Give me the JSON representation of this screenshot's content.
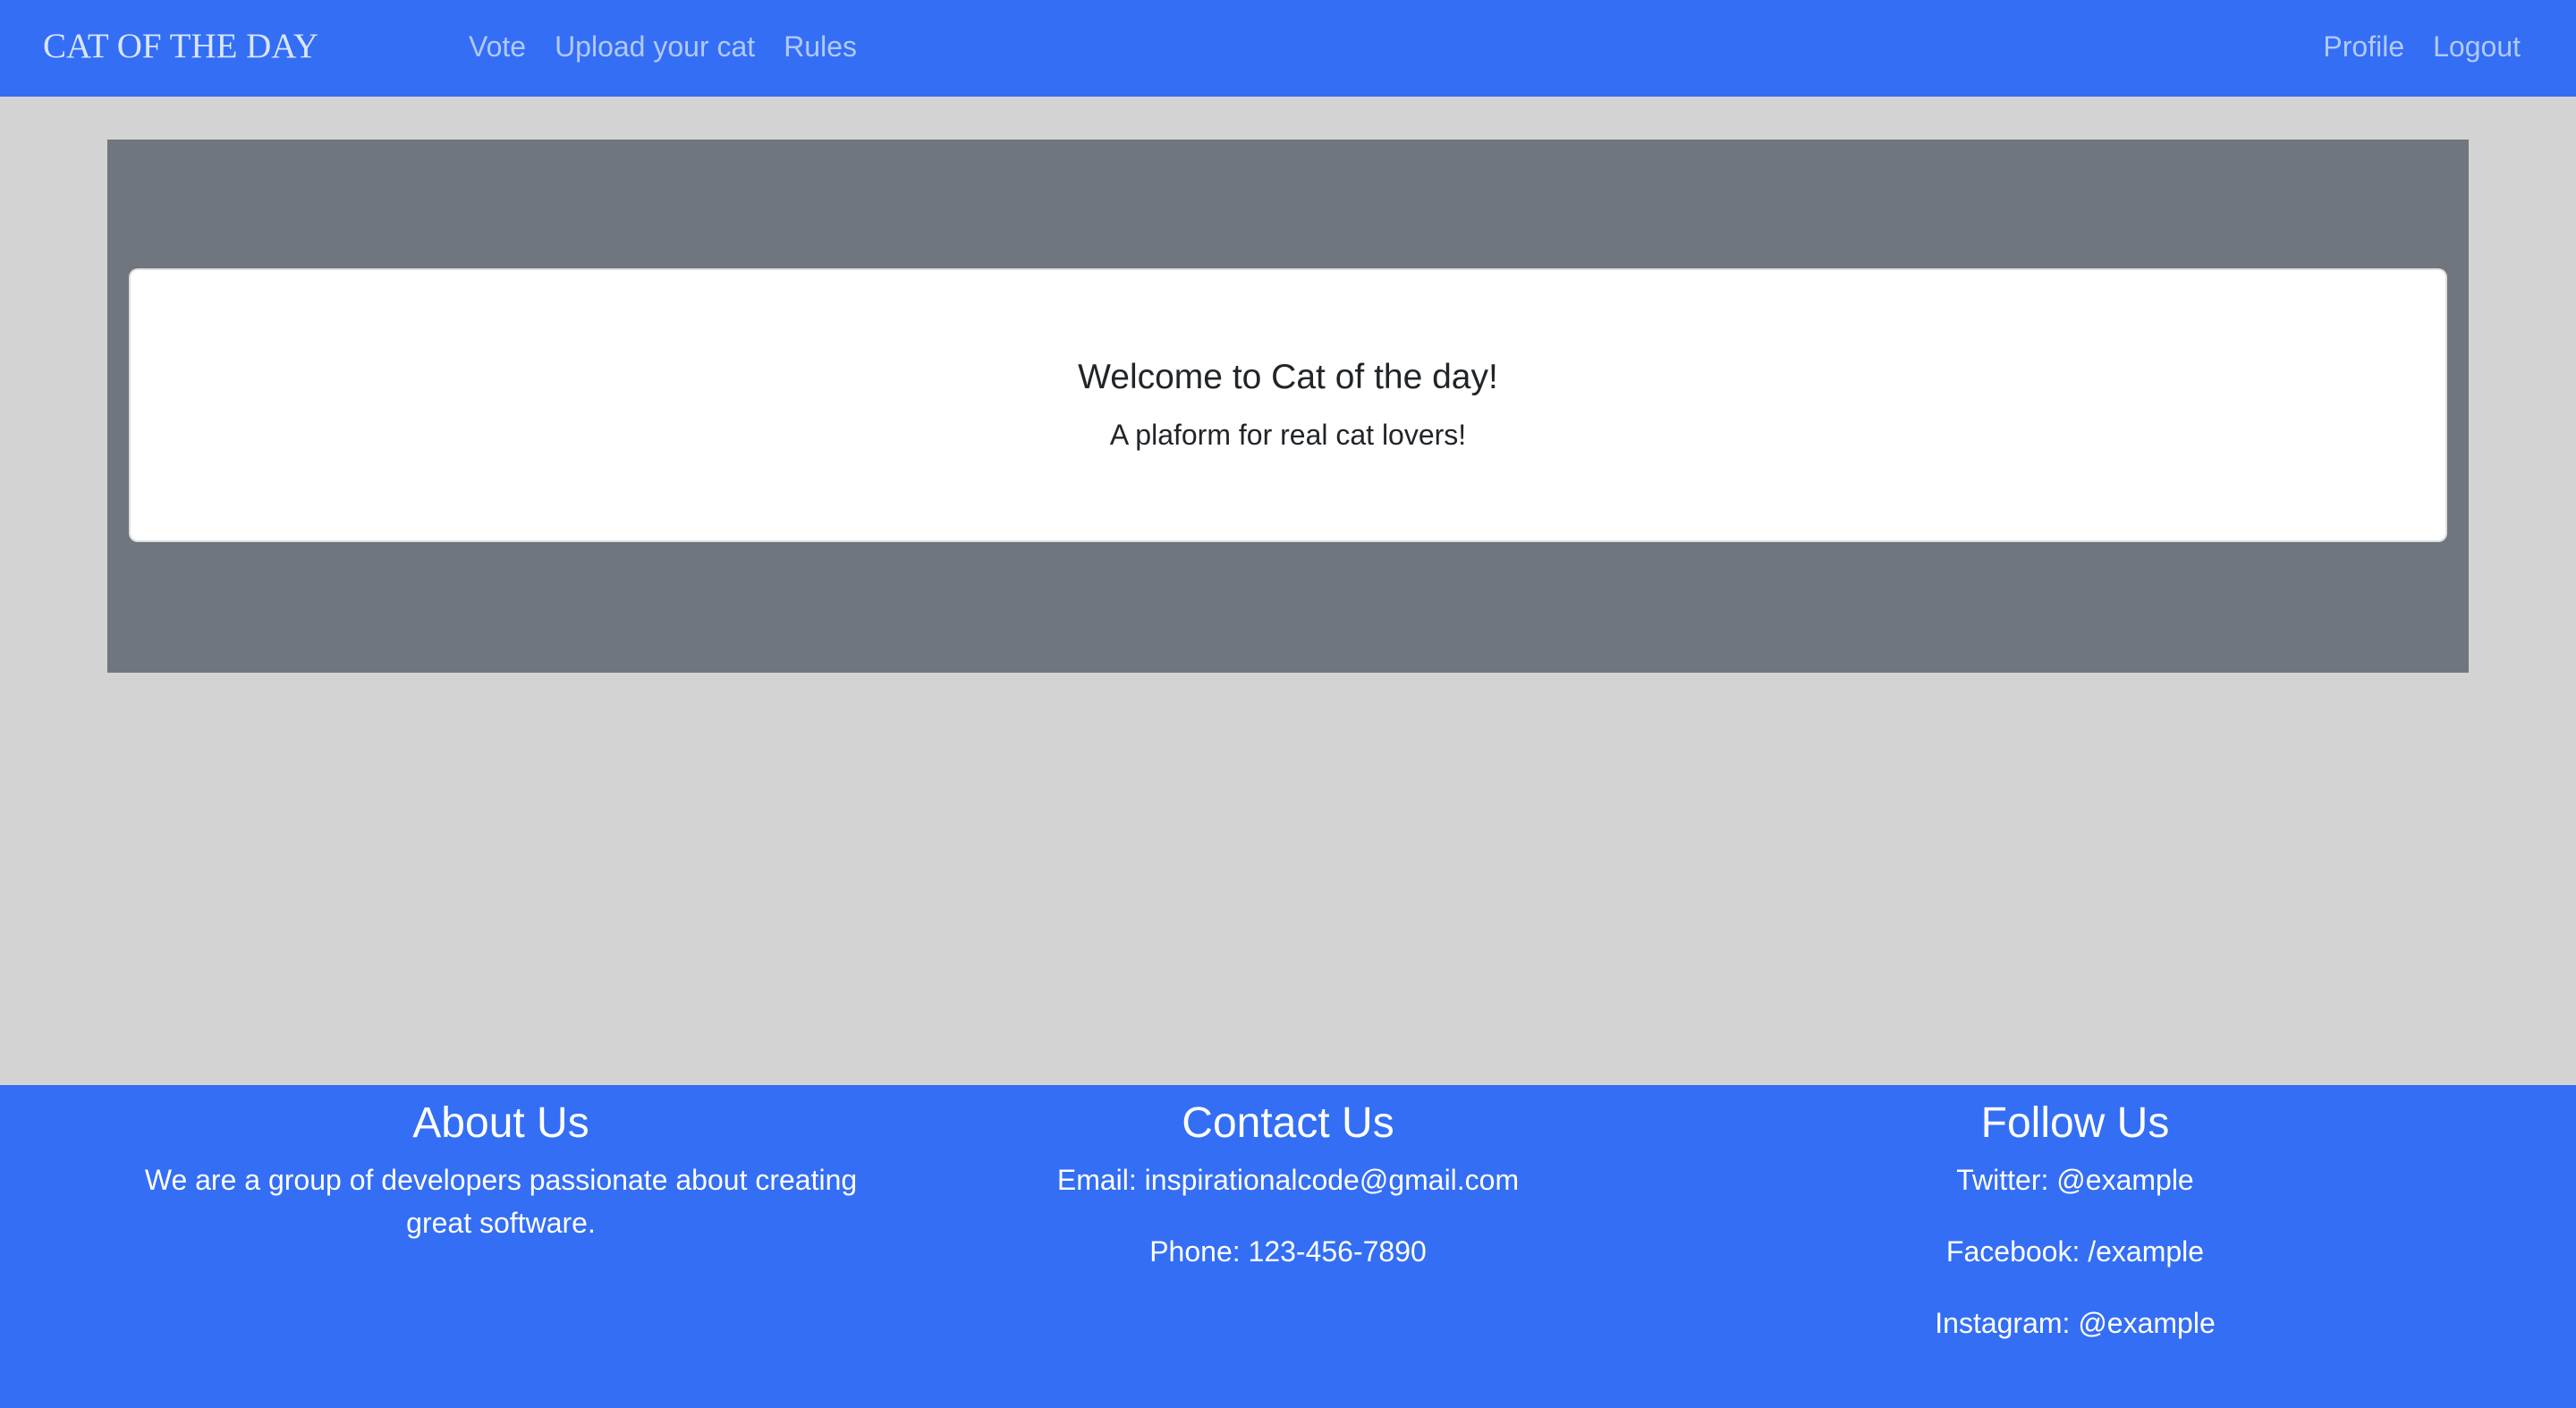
{
  "navbar": {
    "brand": "CAT OF THE DAY",
    "left_links": [
      "Vote",
      "Upload your cat",
      "Rules"
    ],
    "right_links": [
      "Profile",
      "Logout"
    ]
  },
  "hero": {
    "title": "Welcome to Cat of the day!",
    "subtitle": "A plaform for real cat lovers!"
  },
  "footer": {
    "about": {
      "heading": "About Us",
      "text": "We are a group of developers passionate about creating great software."
    },
    "contact": {
      "heading": "Contact Us",
      "email": "Email: inspirationalcode@gmail.com",
      "phone": "Phone: 123-456-7890"
    },
    "follow": {
      "heading": "Follow Us",
      "twitter": "Twitter: @example",
      "facebook": "Facebook: /example",
      "instagram": "Instagram: @example"
    }
  },
  "colors": {
    "primary": "#336ef5",
    "page_background": "#d3d3d3",
    "hero_background": "#6f767e",
    "card_background": "#ffffff",
    "text_dark": "#212529"
  }
}
